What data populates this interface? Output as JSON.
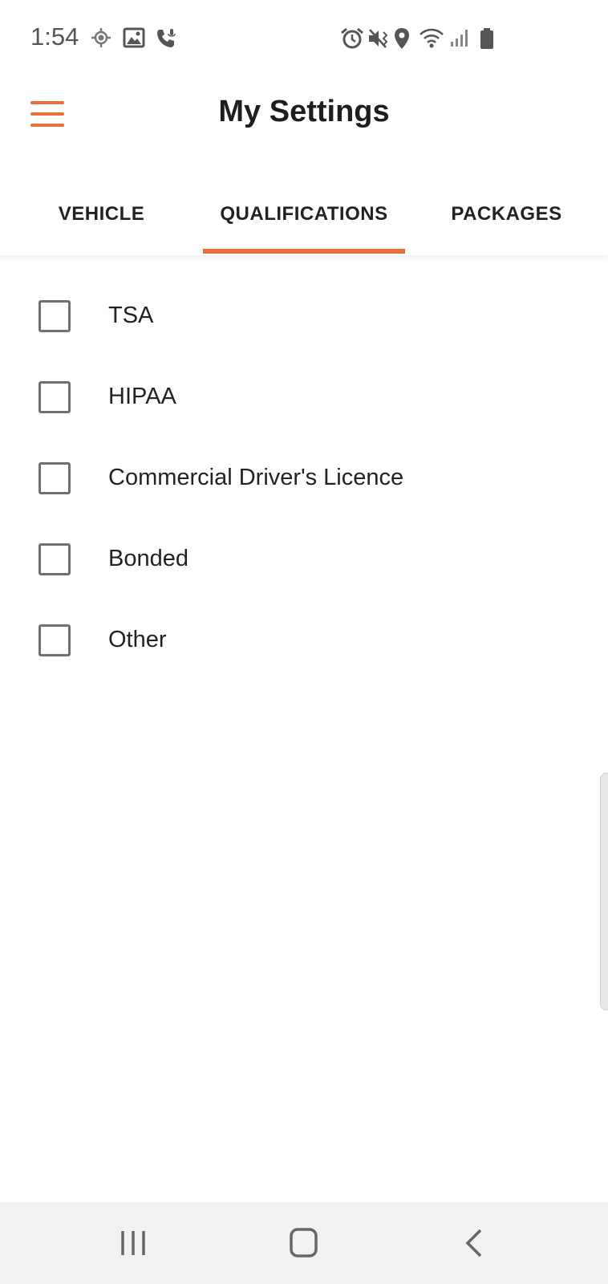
{
  "status_bar": {
    "time": "1:54",
    "left_icons": [
      "location-target-icon",
      "image-icon",
      "call-mic-icon"
    ],
    "right_icons": [
      "alarm-icon",
      "mute-vibrate-icon",
      "location-pin-icon",
      "wifi-icon",
      "signal-icon",
      "battery-icon"
    ]
  },
  "header": {
    "title": "My Settings",
    "menu_icon": "hamburger-menu-icon"
  },
  "tabs": [
    {
      "label": "VEHICLE",
      "active": false
    },
    {
      "label": "QUALIFICATIONS",
      "active": true
    },
    {
      "label": "PACKAGES",
      "active": false
    }
  ],
  "qualifications": [
    {
      "label": "TSA",
      "checked": false
    },
    {
      "label": "HIPAA",
      "checked": false
    },
    {
      "label": "Commercial Driver's Licence",
      "checked": false
    },
    {
      "label": "Bonded",
      "checked": false
    },
    {
      "label": "Other",
      "checked": false
    }
  ],
  "nav_bar": {
    "icons": [
      "recent-apps-icon",
      "home-icon",
      "back-icon"
    ]
  },
  "colors": {
    "accent": "#e8703a",
    "nav_background": "#f1f1f1"
  }
}
